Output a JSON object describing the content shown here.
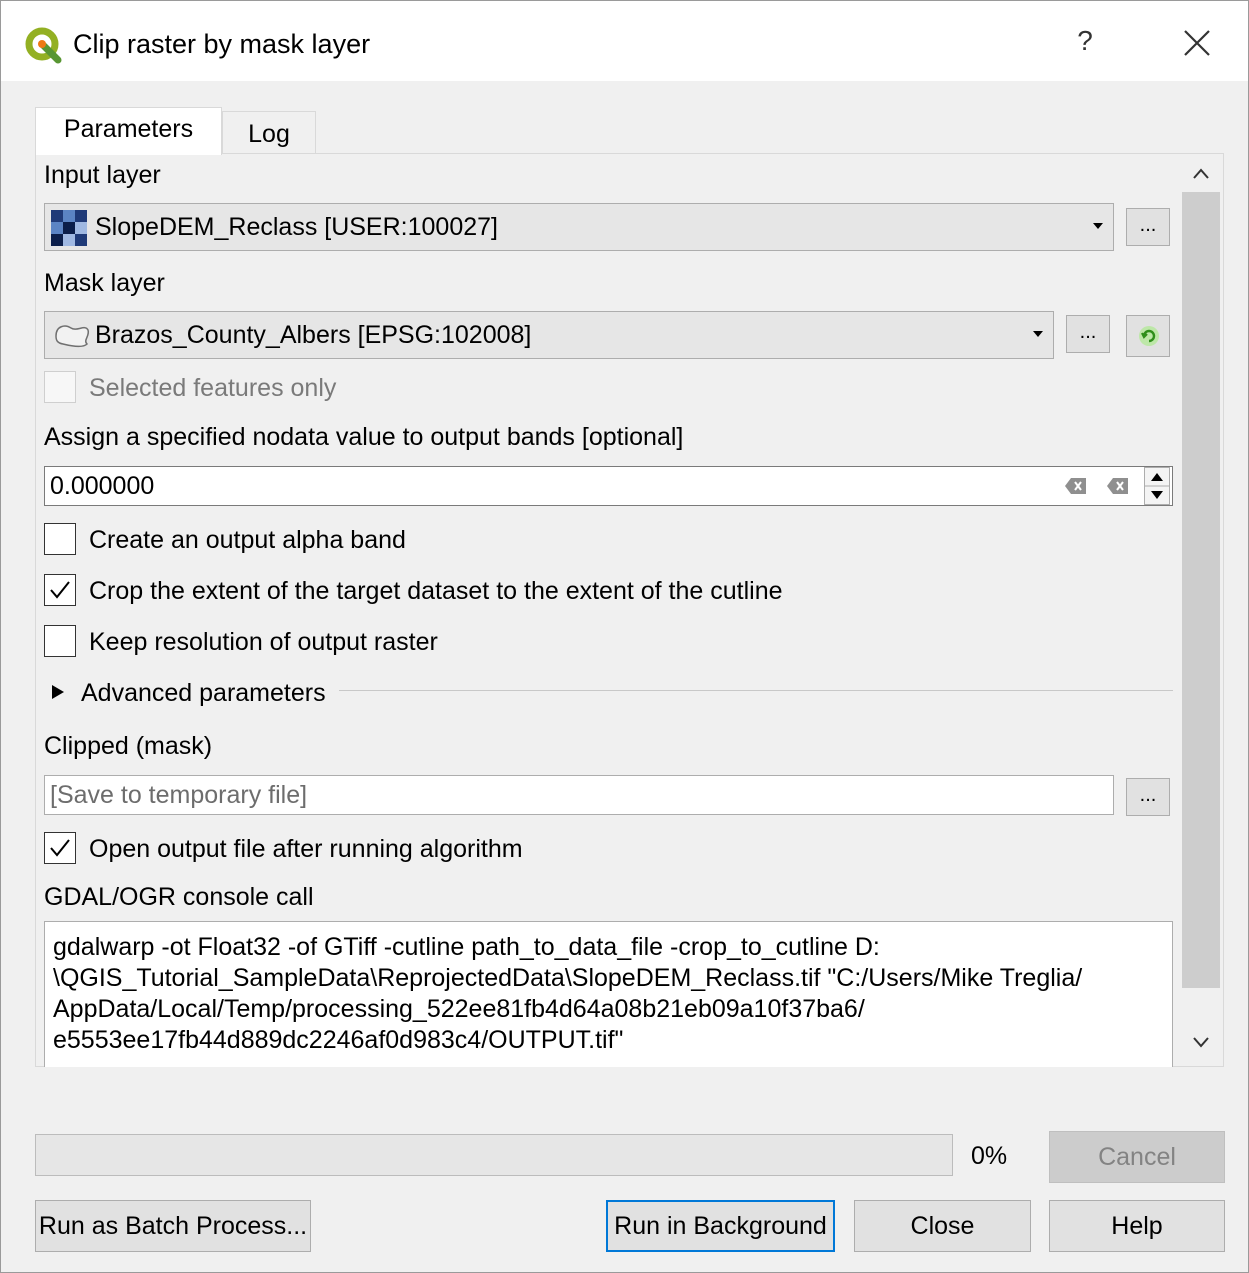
{
  "window": {
    "title": "Clip raster by mask layer",
    "help_label": "?",
    "accent_color": "#0078d7"
  },
  "tabs": [
    {
      "label": "Parameters",
      "active": true
    },
    {
      "label": "Log",
      "active": false
    }
  ],
  "params": {
    "input_layer": {
      "label": "Input layer",
      "value": "SlopeDEM_Reclass [USER:100027]",
      "browse_label": "..."
    },
    "mask_layer": {
      "label": "Mask layer",
      "value": "Brazos_County_Albers [EPSG:102008]",
      "browse_label": "...",
      "selected_only_label": "Selected features only",
      "selected_only_checked": false
    },
    "nodata": {
      "label": "Assign a specified nodata value to output bands [optional]",
      "value": "0.000000"
    },
    "checkboxes": [
      {
        "label": "Create an output alpha band",
        "checked": false
      },
      {
        "label": "Crop the extent of the target dataset to the extent of the cutline",
        "checked": true
      },
      {
        "label": "Keep resolution of output raster",
        "checked": false
      }
    ],
    "advanced_label": "Advanced parameters",
    "output": {
      "label": "Clipped (mask)",
      "placeholder": "[Save to temporary file]",
      "browse_label": "..."
    },
    "open_output": {
      "label": "Open output file after running algorithm",
      "checked": true
    },
    "console": {
      "label": "GDAL/OGR console call",
      "text": "gdalwarp -ot Float32 -of GTiff -cutline path_to_data_file -crop_to_cutline D:\n\\QGIS_Tutorial_SampleData\\ReprojectedData\\SlopeDEM_Reclass.tif \"C:/Users/Mike Treglia/\nAppData/Local/Temp/processing_522ee81fb4d64a08b21eb09a10f37ba6/\ne5553ee17fb44d889dc2246af0d983c4/OUTPUT.tif\""
    }
  },
  "progress": {
    "value": 0,
    "label": "0%"
  },
  "buttons": {
    "cancel": "Cancel",
    "batch": "Run as Batch Process...",
    "run_background": "Run in Background",
    "close": "Close",
    "help": "Help"
  }
}
